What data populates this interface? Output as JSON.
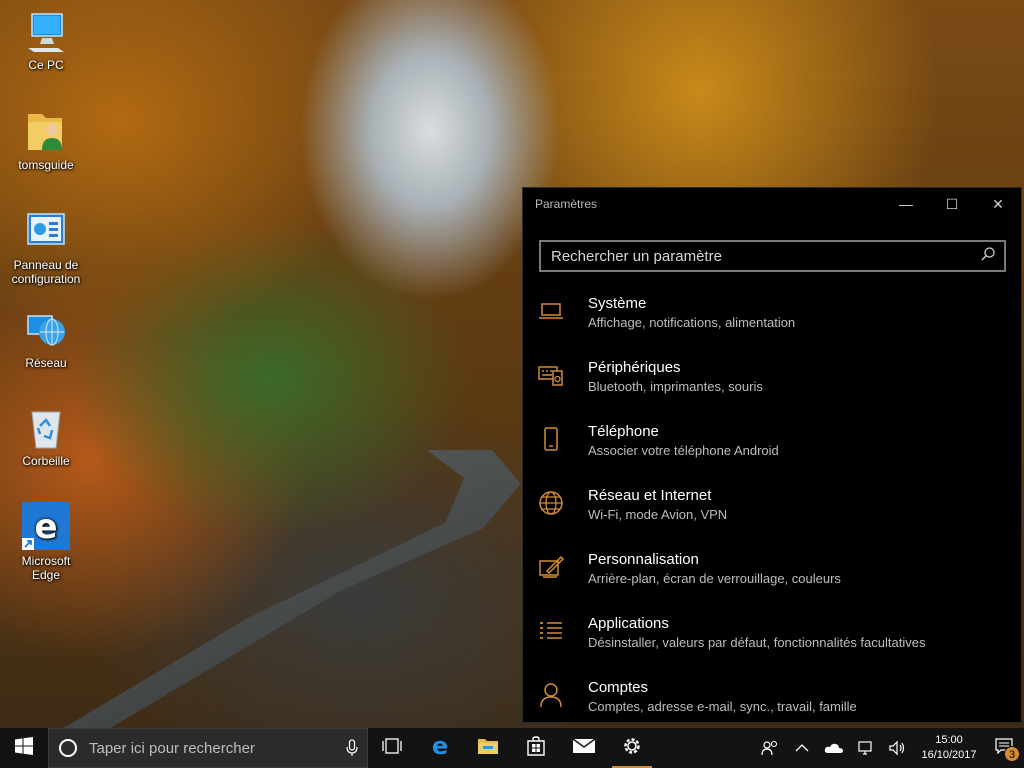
{
  "desktop": {
    "icons": [
      {
        "label": "Ce PC",
        "icon": "monitor-icon"
      },
      {
        "label": "tomsguide",
        "icon": "user-folder-icon"
      },
      {
        "label": "Panneau de configuration",
        "icon": "control-panel-icon"
      },
      {
        "label": "Réseau",
        "icon": "network-globe-icon"
      },
      {
        "label": "Corbeille",
        "icon": "recycle-bin-icon"
      },
      {
        "label": "Microsoft Edge",
        "icon": "edge-icon"
      }
    ]
  },
  "settings": {
    "title": "Paramètres",
    "controls": {
      "minimize": "—",
      "maximize": "☐",
      "close": "✕"
    },
    "search_placeholder": "Rechercher un paramètre",
    "accent": "#d28c33",
    "items": [
      {
        "name": "Système",
        "desc": "Affichage, notifications, alimentation",
        "icon": "laptop-icon"
      },
      {
        "name": "Périphériques",
        "desc": "Bluetooth, imprimantes, souris",
        "icon": "devices-icon"
      },
      {
        "name": "Téléphone",
        "desc": "Associer votre téléphone Android",
        "icon": "phone-icon"
      },
      {
        "name": "Réseau et Internet",
        "desc": "Wi-Fi, mode Avion, VPN",
        "icon": "globe-icon"
      },
      {
        "name": "Personnalisation",
        "desc": "Arrière-plan, écran de verrouillage, couleurs",
        "icon": "paint-icon"
      },
      {
        "name": "Applications",
        "desc": "Désinstaller, valeurs par défaut, fonctionnalités facultatives",
        "icon": "apps-list-icon"
      },
      {
        "name": "Comptes",
        "desc": "Comptes, adresse e-mail, sync., travail, famille",
        "icon": "person-icon"
      }
    ]
  },
  "taskbar": {
    "search_placeholder": "Taper ici pour rechercher",
    "apps": [
      "task-view-icon",
      "edge-icon",
      "file-explorer-icon",
      "store-icon",
      "mail-icon",
      "settings-gear-icon"
    ],
    "tray": [
      "people-icon",
      "chevron-up-icon",
      "onedrive-icon",
      "network-icon",
      "volume-icon"
    ],
    "time": "15:00",
    "date": "16/10/2017",
    "notification_count": "3"
  }
}
